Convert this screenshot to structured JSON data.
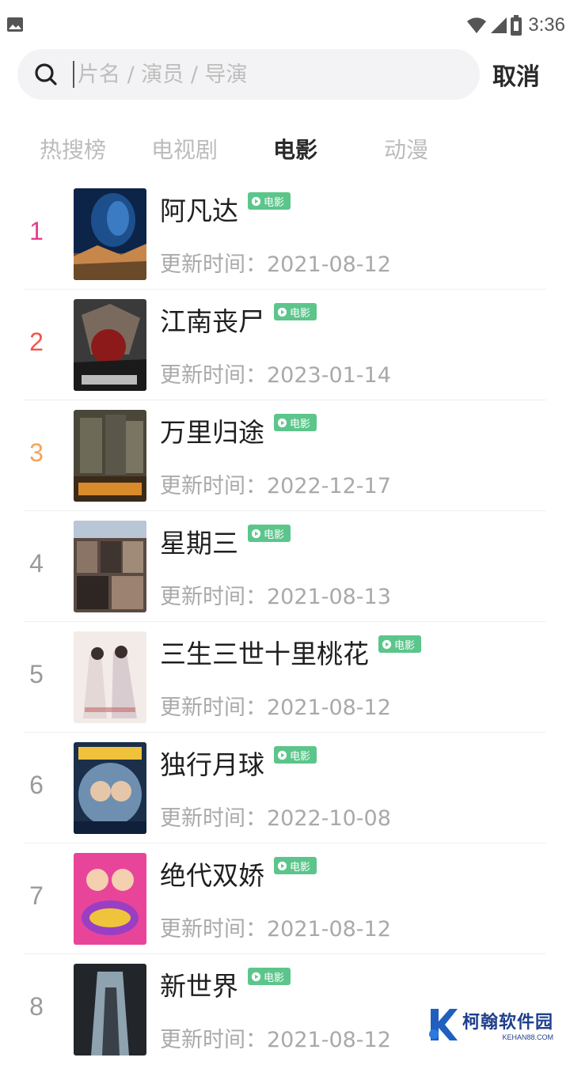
{
  "status_bar": {
    "time": "3:36",
    "icons": [
      "image-icon",
      "wifi-icon",
      "signal-icon",
      "battery-icon"
    ]
  },
  "search": {
    "placeholder": "片名 / 演员 / 导演",
    "value": "",
    "cancel_label": "取消"
  },
  "tabs": [
    {
      "label": "热搜榜",
      "active": false
    },
    {
      "label": "电视剧",
      "active": false
    },
    {
      "label": "电影",
      "active": true
    },
    {
      "label": "动漫",
      "active": false
    }
  ],
  "colors": {
    "rank_1": "#e83e8c",
    "rank_2": "#f2564a",
    "rank_3": "#f5a35a",
    "rank_default": "#9a9a9a",
    "badge": "#5cc58b"
  },
  "items": [
    {
      "rank": "1",
      "title": "阿凡达",
      "badge": "电影",
      "update": "更新时间：2021-08-12"
    },
    {
      "rank": "2",
      "title": "江南丧尸",
      "badge": "电影",
      "update": "更新时间：2023-01-14"
    },
    {
      "rank": "3",
      "title": "万里归途",
      "badge": "电影",
      "update": "更新时间：2022-12-17"
    },
    {
      "rank": "4",
      "title": "星期三",
      "badge": "电影",
      "update": "更新时间：2021-08-13"
    },
    {
      "rank": "5",
      "title": "三生三世十里桃花",
      "badge": "电影",
      "update": "更新时间：2021-08-12"
    },
    {
      "rank": "6",
      "title": "独行月球",
      "badge": "电影",
      "update": "更新时间：2022-10-08"
    },
    {
      "rank": "7",
      "title": "绝代双娇",
      "badge": "电影",
      "update": "更新时间：2021-08-12"
    },
    {
      "rank": "8",
      "title": "新世界",
      "badge": "电影",
      "update": "更新时间：2021-08-12"
    }
  ],
  "watermark": {
    "name": "柯翰软件园",
    "domain": "KEHAN88.COM"
  }
}
